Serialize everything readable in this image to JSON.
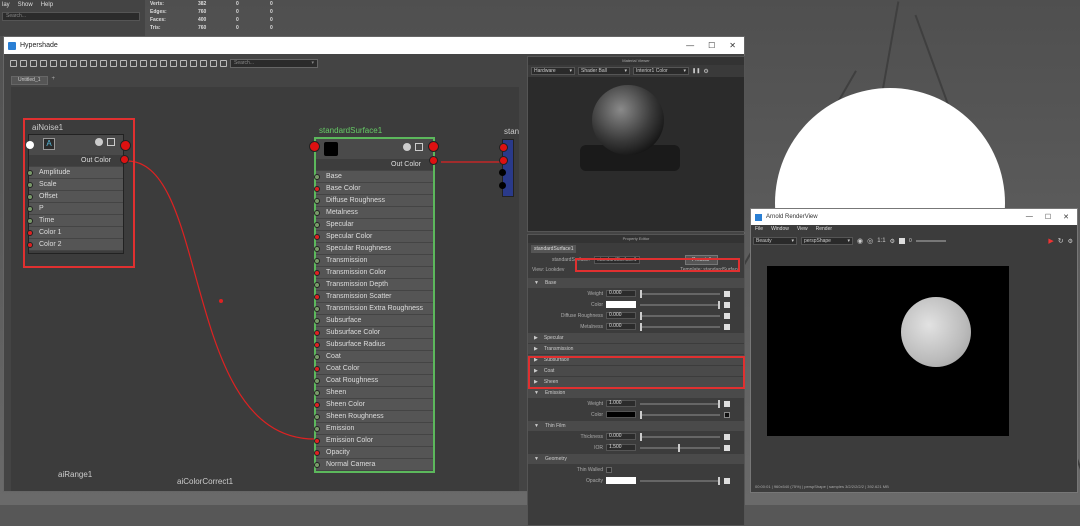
{
  "menubar": {
    "items": [
      "lay",
      "Show",
      "Help"
    ]
  },
  "left_search": {
    "placeholder": "Search..."
  },
  "stats": {
    "rows": [
      {
        "label": "Verts:",
        "a": "382",
        "b": "0",
        "c": "0"
      },
      {
        "label": "Edges:",
        "a": "760",
        "b": "0",
        "c": "0"
      },
      {
        "label": "Faces:",
        "a": "400",
        "b": "0",
        "c": "0"
      },
      {
        "label": "Tris:",
        "a": "760",
        "b": "0",
        "c": "0"
      }
    ]
  },
  "hypershade": {
    "title": "Hypershade",
    "search_placeholder": "Search...",
    "tab": "Untitled_1"
  },
  "nodes": {
    "ainoise": {
      "title": "aiNoise1",
      "out": "Out Color",
      "attrs": [
        "Amplitude",
        "Scale",
        "Offset",
        "P",
        "Time",
        "Color 1",
        "Color 2"
      ]
    },
    "standard": {
      "title": "standardSurface1",
      "out": "Out Color",
      "attrs": [
        "Base",
        "Base Color",
        "Diffuse Roughness",
        "Metalness",
        "Specular",
        "Specular Color",
        "Specular Roughness",
        "Transmission",
        "Transmission Color",
        "Transmission Depth",
        "Transmission Scatter",
        "Transmission Extra Roughness",
        "Subsurface",
        "Subsurface Color",
        "Subsurface Radius",
        "Coat",
        "Coat Color",
        "Coat Roughness",
        "Sheen",
        "Sheen Color",
        "Sheen Roughness",
        "Emission",
        "Emission Color",
        "Opacity",
        "Normal Camera"
      ]
    },
    "airange": {
      "title": "aiRange1"
    },
    "aicolorcorrect": {
      "title": "aiColorCorrect1"
    },
    "sg": {
      "title": "stan"
    }
  },
  "material_viewer": {
    "title": "Material Viewer",
    "renderer": "Hardware",
    "shape": "Shader Ball",
    "env": "Interior1 Color"
  },
  "property_editor": {
    "title": "Property Editor",
    "tab": "standardSurface1",
    "type_label": "standardSurface:",
    "node_name": "standardSurface1",
    "presets": "Presets*",
    "view_label": "View: Lookdev",
    "template_label": "Template: standardSurface",
    "base_section": "Base",
    "base_rows": [
      {
        "label": "Weight",
        "value": "0.000"
      },
      {
        "label": "Color",
        "value": ""
      },
      {
        "label": "Diffuse Roughness",
        "value": "0.000"
      },
      {
        "label": "Metalness",
        "value": "0.000"
      }
    ],
    "collapsed_sections": [
      "Specular",
      "Transmission",
      "Subsurface",
      "Coat",
      "Sheen"
    ],
    "emission_section": "Emission",
    "emission_rows": [
      {
        "label": "Weight",
        "value": "1.000"
      },
      {
        "label": "Color",
        "value": ""
      }
    ],
    "thinfilm_section": "Thin Film",
    "thinfilm_rows": [
      {
        "label": "Thickness",
        "value": "0.000"
      },
      {
        "label": "IOR",
        "value": "1.500"
      }
    ],
    "geometry_section": "Geometry",
    "geometry_rows": [
      {
        "label": "Thin Walled"
      },
      {
        "label": "Opacity"
      }
    ]
  },
  "arnold": {
    "title": "Arnold RenderView",
    "menu": [
      "File",
      "Window",
      "View",
      "Render"
    ],
    "aov": "Beauty",
    "camera": "perspShape",
    "ratio": "1:1",
    "exposure": "0",
    "status": "00:00:01 | 960x540 (75%) | perspShape | samples 3/2/2/2/2/2 | 392.621 MB"
  },
  "colors": {
    "highlight": "#e03030",
    "node_border": "#5cb85c",
    "accent": "#2a7fd4"
  }
}
